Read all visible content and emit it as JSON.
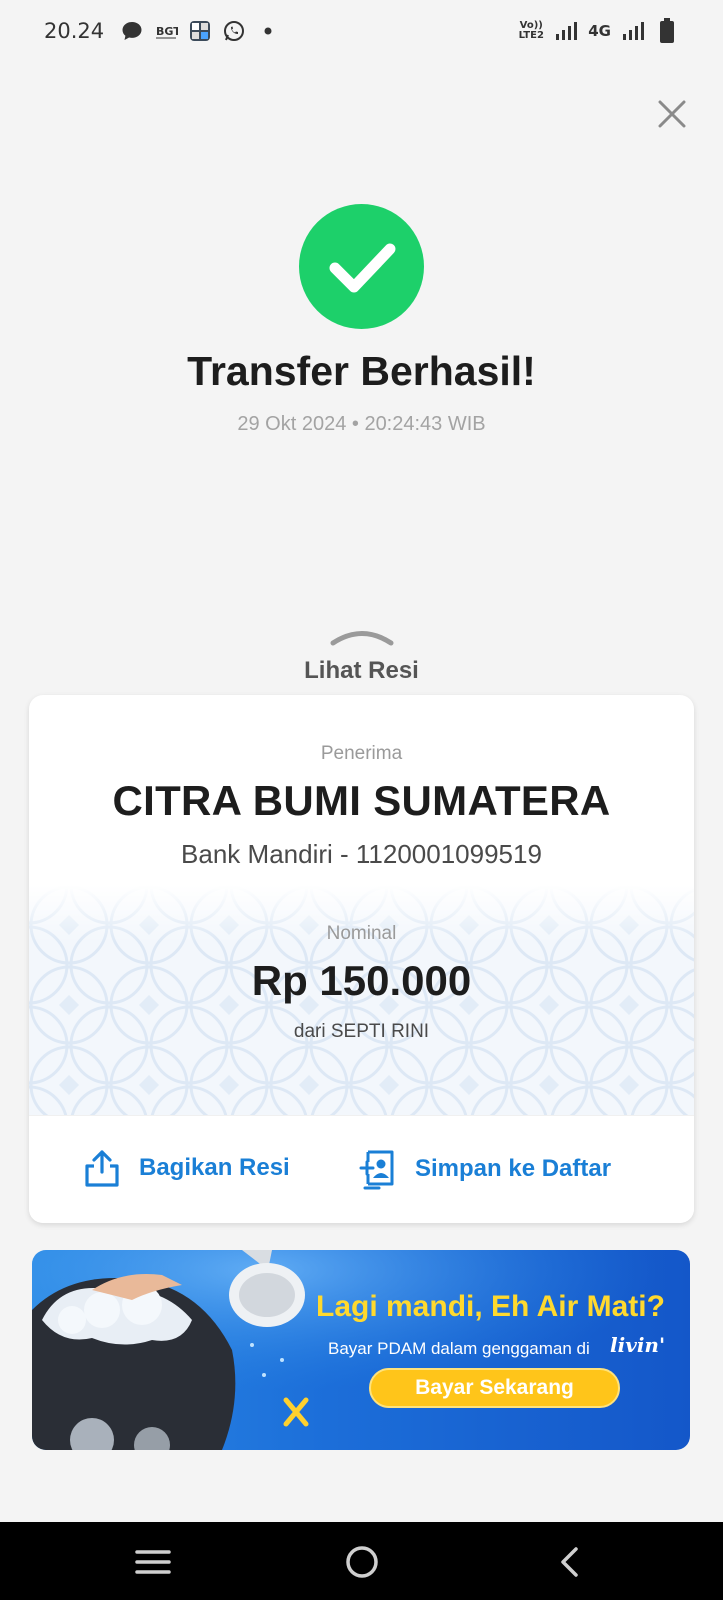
{
  "status_bar": {
    "time": "20.24",
    "volte_label": "Vo)) LTE2",
    "network_label": "4G",
    "icons": [
      "message-icon",
      "bell-icon",
      "calculator-icon",
      "whatsapp-icon",
      "dot-icon",
      "signal-icon",
      "signal-icon",
      "battery-icon"
    ]
  },
  "header": {
    "close_icon": "close-icon"
  },
  "result": {
    "status_icon": "check-icon",
    "status_color": "#1dd06a",
    "title": "Transfer Berhasil!",
    "datetime": "29 Okt 2024 • 20:24:43 WIB"
  },
  "lihat_resi": {
    "label": "Lihat Resi",
    "icon": "chevron-up-icon"
  },
  "receipt": {
    "recipient_label": "Penerima",
    "recipient_name": "CITRA BUMI SUMATERA",
    "recipient_bank": "Bank Mandiri - 1120001099519",
    "amount_label": "Nominal",
    "amount": "Rp 150.000",
    "sender": "dari SEPTI RINI",
    "actions": [
      {
        "label": "Bagikan Resi",
        "icon": "share-icon"
      },
      {
        "label": "Simpan ke Daftar",
        "icon": "contact-add-icon"
      }
    ],
    "accent_color": "#1a7fd6"
  },
  "banner": {
    "headline": "Lagi mandi, Eh Air Mati?",
    "subtext": "Bayar PDAM dalam genggaman di",
    "brand": "livin'",
    "button_label": "Bayar Sekarang"
  },
  "nav": {
    "icons": [
      "menu-icon",
      "home-icon",
      "back-icon"
    ]
  }
}
